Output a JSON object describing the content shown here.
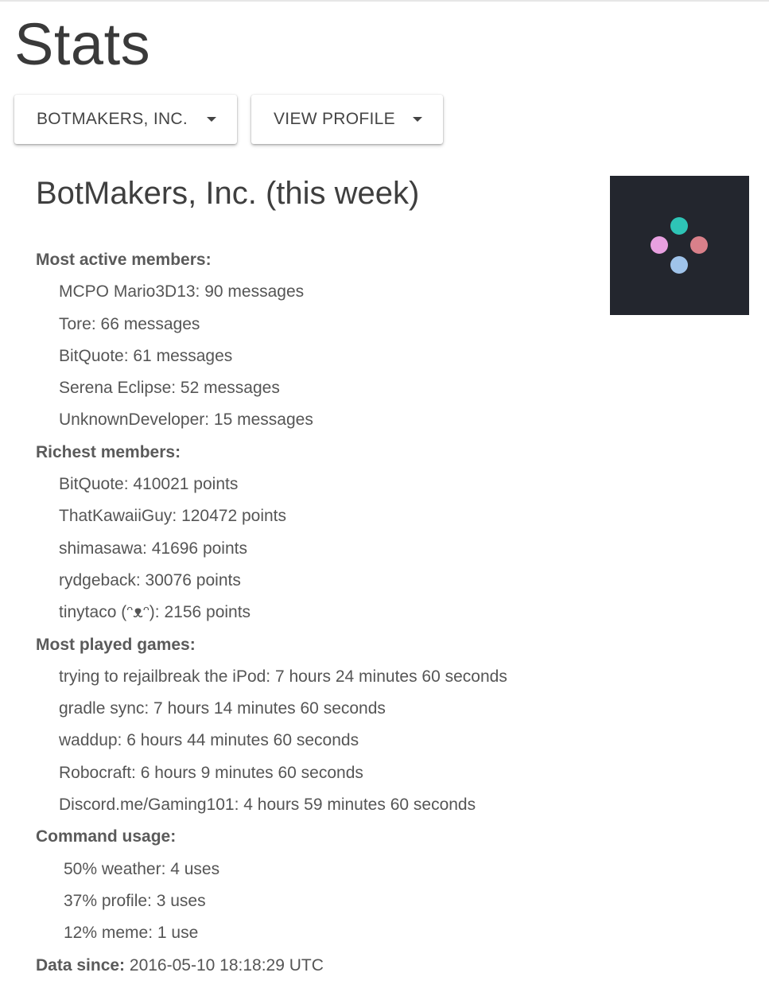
{
  "page": {
    "title": "Stats"
  },
  "dropdowns": {
    "server": {
      "label": "BOTMAKERS, INC."
    },
    "view": {
      "label": "VIEW PROFILE"
    }
  },
  "server": {
    "heading": "BotMakers, Inc. (this week)",
    "icon": {
      "background": "#23262e",
      "dot_colors": {
        "top": "#2ec4b6",
        "left": "#e8a0e0",
        "right": "#d9808a",
        "bottom": "#9fc3ea"
      }
    }
  },
  "sections": {
    "active": {
      "label": "Most active members:",
      "items": [
        "MCPO Mario3D13: 90 messages",
        "Tore: 66 messages",
        "BitQuote: 61 messages",
        "Serena Eclipse: 52 messages",
        "UnknownDeveloper: 15 messages"
      ]
    },
    "richest": {
      "label": "Richest members:",
      "items": [
        "BitQuote: 410021 points",
        "ThatKawaiiGuy: 120472 points",
        "shimasawa: 41696 points",
        "rydgeback: 30076 points",
        "tinytaco (ᵔᴥᵔ): 2156 points"
      ]
    },
    "games": {
      "label": "Most played games:",
      "items": [
        "trying to rejailbreak the iPod: 7 hours 24 minutes 60 seconds",
        "gradle sync: 7 hours 14 minutes 60 seconds",
        "waddup: 6 hours 44 minutes 60 seconds",
        "Robocraft: 6 hours 9 minutes 60 seconds",
        "Discord.me/Gaming101: 4 hours 59 minutes 60 seconds"
      ]
    },
    "commands": {
      "label": "Command usage:",
      "items": [
        "50% weather: 4 uses",
        "37% profile: 3 uses",
        "12% meme: 1 use"
      ]
    }
  },
  "data_since": {
    "label": "Data since:",
    "value": "2016-05-10 18:18:29 UTC"
  }
}
